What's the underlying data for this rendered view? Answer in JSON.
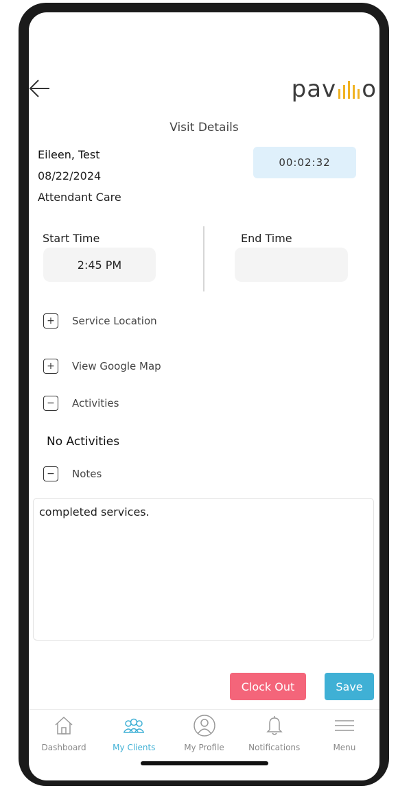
{
  "header": {
    "logo_text_left": "pav",
    "logo_text_right": "o",
    "logo_bar_color": "#f0b323",
    "back_icon": "arrow-left-icon"
  },
  "page": {
    "title": "Visit Details"
  },
  "visit": {
    "client_name": "Eileen, Test",
    "date": "08/22/2024",
    "service_type": "Attendant Care",
    "timer": "00:02:32"
  },
  "times": {
    "start_label": "Start Time",
    "start_value": "2:45 PM",
    "end_label": "End Time",
    "end_value": ""
  },
  "sections": {
    "service_location": {
      "label": "Service Location",
      "state_icon": "+"
    },
    "google_map": {
      "label": "View Google Map",
      "state_icon": "+"
    },
    "activities": {
      "label": "Activities",
      "state_icon": "−",
      "empty_text": "No Activities"
    },
    "notes": {
      "label": "Notes",
      "state_icon": "−",
      "value": "completed services."
    }
  },
  "actions": {
    "clock_out_label": "Clock Out",
    "save_label": "Save",
    "clock_out_color": "#f4657a",
    "save_color": "#3fb0d5"
  },
  "tabbar": {
    "active_color": "#3fb0d5",
    "items": [
      {
        "label": "Dashboard",
        "icon": "home-icon"
      },
      {
        "label": "My Clients",
        "icon": "clients-icon",
        "active": true
      },
      {
        "label": "My Profile",
        "icon": "profile-icon"
      },
      {
        "label": "Notifications",
        "icon": "bell-icon"
      },
      {
        "label": "Menu",
        "icon": "hamburger-menu-icon"
      }
    ]
  }
}
